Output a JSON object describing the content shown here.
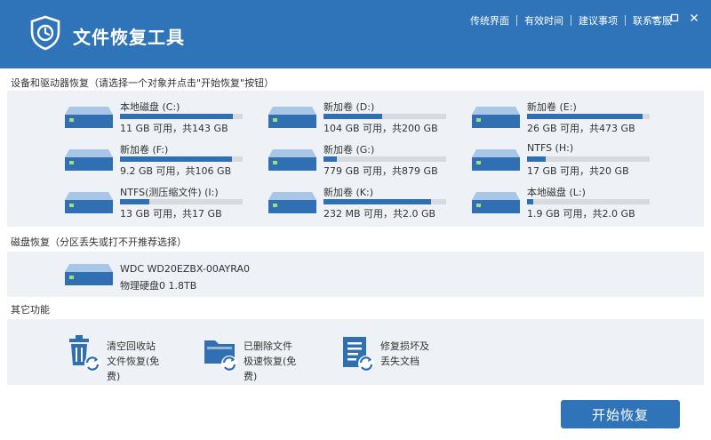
{
  "header": {
    "title": "文件恢复工具",
    "links": [
      "传统界面",
      "有效时间",
      "建议事项",
      "联系客服"
    ],
    "colors": {
      "brand": "#2f73b8"
    }
  },
  "sections": {
    "drives_title": "设备和驱动器恢复（请选择一个对象并点击\"开始恢复\"按钮）",
    "disk_title": "磁盘恢复（分区丢失或打不开推荐选择）",
    "other_title": "其它功能"
  },
  "drives": [
    {
      "name": "本地磁盘  (C:)",
      "info": "11 GB 可用，共143 GB",
      "used": 0.92
    },
    {
      "name": "新加卷  (D:)",
      "info": "104 GB 可用，共200 GB",
      "used": 0.48
    },
    {
      "name": "新加卷  (E:)",
      "info": "26 GB 可用，共473 GB",
      "used": 0.94
    },
    {
      "name": "新加卷  (F:)",
      "info": "9.2 GB 可用，共106 GB",
      "used": 0.91
    },
    {
      "name": "新加卷  (G:)",
      "info": "779 GB 可用，共879 GB",
      "used": 0.11
    },
    {
      "name": "NTFS  (H:)",
      "info": "17 GB 可用，共20 GB",
      "used": 0.15
    },
    {
      "name": "NTFS(测压缩文件)  (I:)",
      "info": "13 GB 可用，共17 GB",
      "used": 0.24
    },
    {
      "name": "新加卷  (K:)",
      "info": "232 MB 可用，共2.0 GB",
      "used": 0.88
    },
    {
      "name": "本地磁盘  (L:)",
      "info": "1.9 GB 可用，共2.0 GB",
      "used": 0.05
    }
  ],
  "disk": {
    "name": "WDC WD20EZBX-00AYRA0",
    "info": "物理硬盘0  1.8TB"
  },
  "functions": [
    {
      "label": "清空回收站文件恢复(免费)",
      "icon": "recycle-bin-icon"
    },
    {
      "label": "已删除文件极速恢复(免费)",
      "icon": "folder-recover-icon"
    },
    {
      "label": "修复损坏及丢失文档",
      "icon": "document-repair-icon"
    }
  ],
  "start_button": "开始恢复"
}
